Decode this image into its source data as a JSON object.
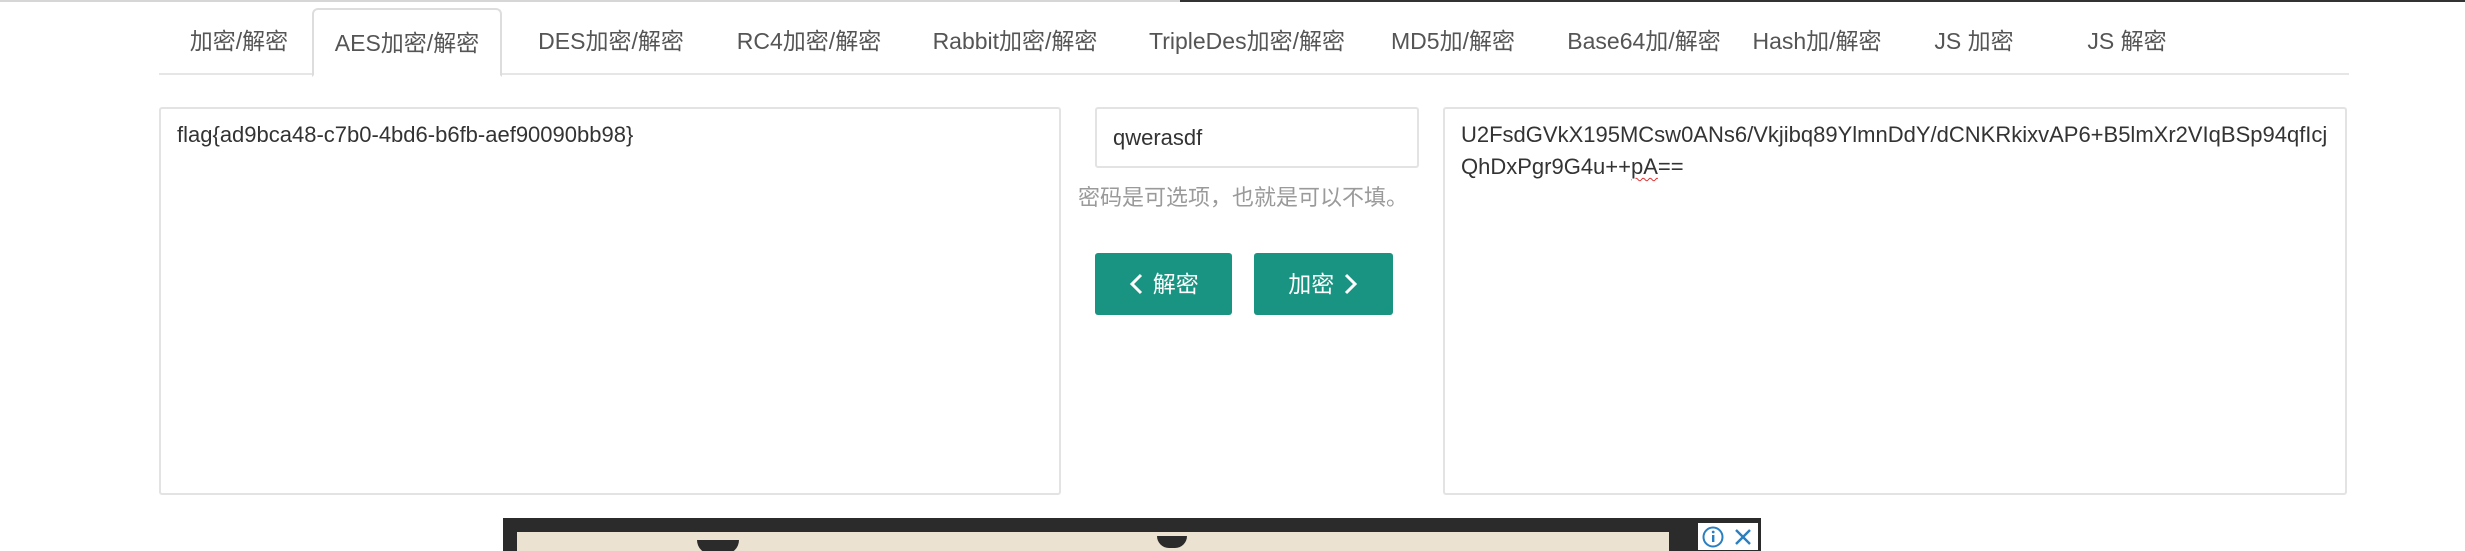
{
  "tabs": {
    "items": [
      {
        "label": "加密/解密"
      },
      {
        "label": "AES加密/解密"
      },
      {
        "label": "DES加密/解密"
      },
      {
        "label": "RC4加密/解密"
      },
      {
        "label": "Rabbit加密/解密"
      },
      {
        "label": "TripleDes加密/解密"
      },
      {
        "label": "MD5加/解密"
      },
      {
        "label": "Base64加/解密"
      },
      {
        "label": "Hash加/解密"
      },
      {
        "label": "JS 加密"
      },
      {
        "label": "JS 解密"
      }
    ],
    "active_index": 1
  },
  "input": {
    "text": "flag{ad9bca48-c7b0-4bd6-b6fb-aef90090bb98}"
  },
  "password": {
    "value": "qwerasdf",
    "hint": "密码是可选项，也就是可以不填。"
  },
  "buttons": {
    "decrypt_label": "解密",
    "encrypt_label": "加密"
  },
  "output": {
    "text_main": "U2FsdGVkX195MCsw0ANs6/Vkjibq89YlmnDdY/dCNKRkixvAP6+B5lmXr2VIqBSp94qfIcjQhDxPgr9G4u++",
    "text_flagged": "pA",
    "text_tail": "=="
  },
  "ad": {
    "info_icon": "info-icon",
    "close_icon": "close-icon"
  },
  "colors": {
    "accent": "#1a9482",
    "hint": "#9a9a9a",
    "border": "#e3e3e3"
  }
}
